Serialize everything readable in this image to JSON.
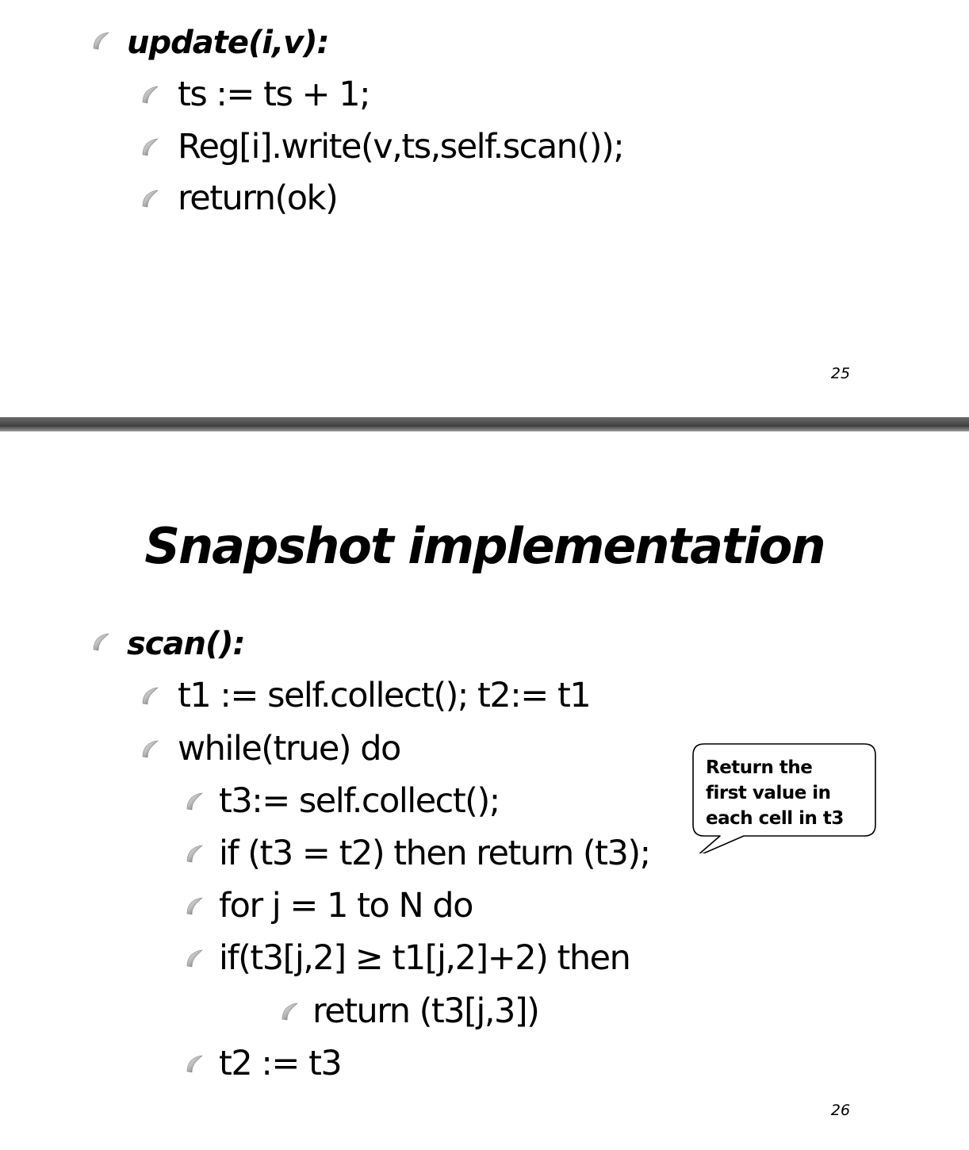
{
  "slide_25": {
    "heading": "update(i,v):",
    "lines": [
      "ts := ts + 1;",
      "Reg[i].write(v,ts,self.scan());",
      "return(ok)"
    ],
    "page_number": "25"
  },
  "slide_26": {
    "title": "Snapshot implementation",
    "heading": "scan():",
    "lines": [
      "t1 := self.collect(); t2:= t1",
      "while(true) do",
      "t3:= self.collect();",
      "if (t3 = t2) then return (t3);",
      "for j = 1 to N do",
      "if(t3[j,2] ≥ t1[j,2]+2) then",
      "return (t3[j,3])",
      "t2 := t3"
    ],
    "callout": {
      "line1": "Return the",
      "line2": "first value in",
      "line3": "each cell in t3"
    },
    "page_number": "26"
  },
  "colors": {
    "divider": "#4e4e4e",
    "bullet_light": "#f2f2f2",
    "bullet_dark": "#5a5a5a"
  },
  "icons": {
    "bullet": "curved-swoosh-bullet-icon"
  }
}
